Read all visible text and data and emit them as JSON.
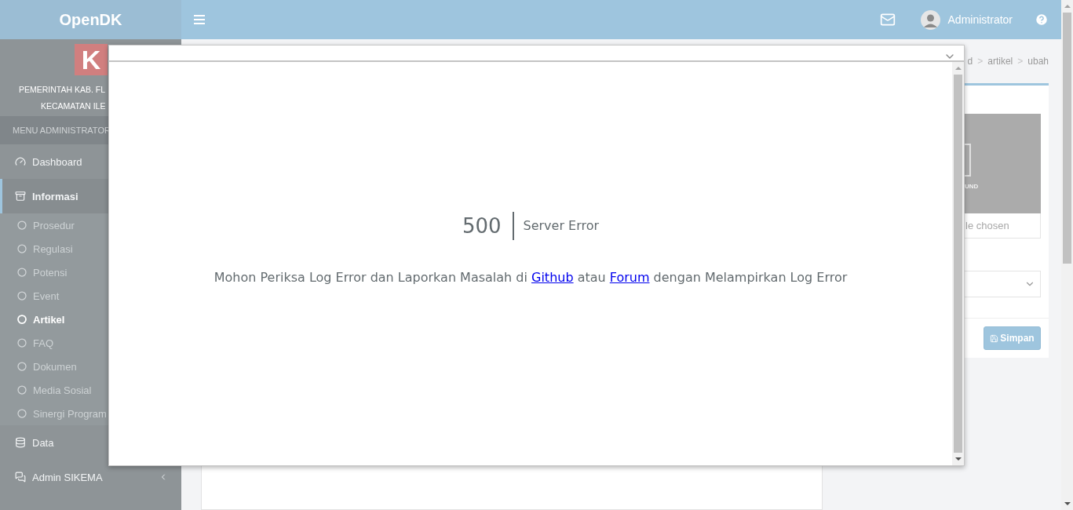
{
  "brand": {
    "name": "OpenDK",
    "logo_letter": "K",
    "org_lines": [
      "PEMERINTAH KAB. FL",
      "KECAMATAN ILE"
    ]
  },
  "sidebar": {
    "header": "MENU ADMINISTRATOR",
    "items": [
      {
        "label": "Dashboard",
        "kind": "link",
        "selected": false
      },
      {
        "label": "Informasi",
        "kind": "open_tree",
        "selected": true,
        "children": [
          {
            "label": "Prosedur",
            "selected": false
          },
          {
            "label": "Regulasi",
            "selected": false
          },
          {
            "label": "Potensi",
            "selected": false
          },
          {
            "label": "Event",
            "selected": false
          },
          {
            "label": "Artikel",
            "selected": true
          },
          {
            "label": "FAQ",
            "selected": false
          },
          {
            "label": "Dokumen",
            "selected": false
          },
          {
            "label": "Media Sosial",
            "selected": false
          },
          {
            "label": "Sinergi Program",
            "selected": false
          }
        ]
      },
      {
        "label": "Data",
        "kind": "link",
        "selected": false
      },
      {
        "label": "Admin SIKEMA",
        "kind": "tree",
        "selected": false
      }
    ]
  },
  "topbar": {
    "user": "Administrator"
  },
  "breadcrumb": [
    "d",
    "artikel",
    "ubah"
  ],
  "breadcrumb_separator": ">",
  "side_card": {
    "image_caption": "UND",
    "file_text": "le chosen",
    "save_button": "Simpan"
  },
  "modal": {
    "code": "500",
    "title": "Server Error",
    "message": [
      {
        "kind": "text",
        "text": "Mohon Periksa Log Error dan Laporkan Masalah di "
      },
      {
        "kind": "link",
        "text": "Github"
      },
      {
        "kind": "text",
        "text": " atau "
      },
      {
        "kind": "link",
        "text": "Forum"
      },
      {
        "kind": "text",
        "text": " dengan Melampirkan Log Error"
      }
    ]
  }
}
